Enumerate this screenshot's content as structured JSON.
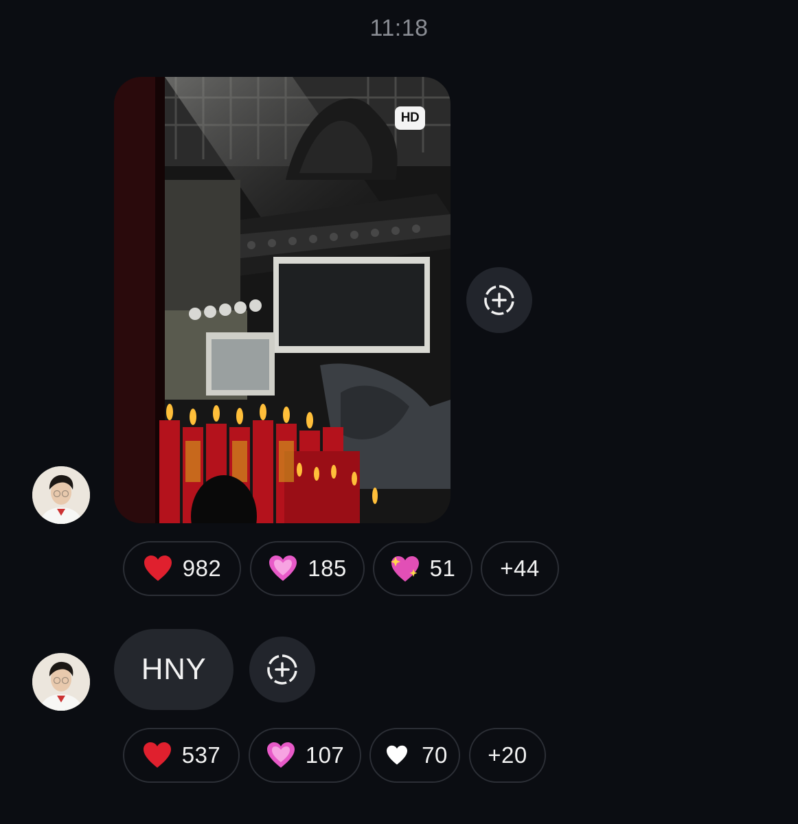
{
  "timestamp": "11:18",
  "messages": [
    {
      "type": "photo",
      "badge": "HD",
      "avatar_icon": "profile-avatar",
      "add_reaction_icon": "add-reaction-icon",
      "reactions": [
        {
          "emoji": "red-heart",
          "count": "982"
        },
        {
          "emoji": "pink-heart",
          "count": "185"
        },
        {
          "emoji": "sparkling-heart",
          "count": "51"
        },
        {
          "more": "+44"
        }
      ]
    },
    {
      "type": "text",
      "text": "HNY",
      "avatar_icon": "profile-avatar",
      "add_reaction_icon": "add-reaction-icon",
      "reactions": [
        {
          "emoji": "red-heart",
          "count": "537"
        },
        {
          "emoji": "pink-heart",
          "count": "107"
        },
        {
          "emoji": "white-heart",
          "count": "70"
        },
        {
          "more": "+20"
        }
      ]
    }
  ],
  "colors": {
    "background": "#0b0d12",
    "bubble": "#24272d",
    "timestamp": "#8a8d94",
    "red_heart": "#e0202e",
    "pink_heart": "#e85ac8"
  }
}
